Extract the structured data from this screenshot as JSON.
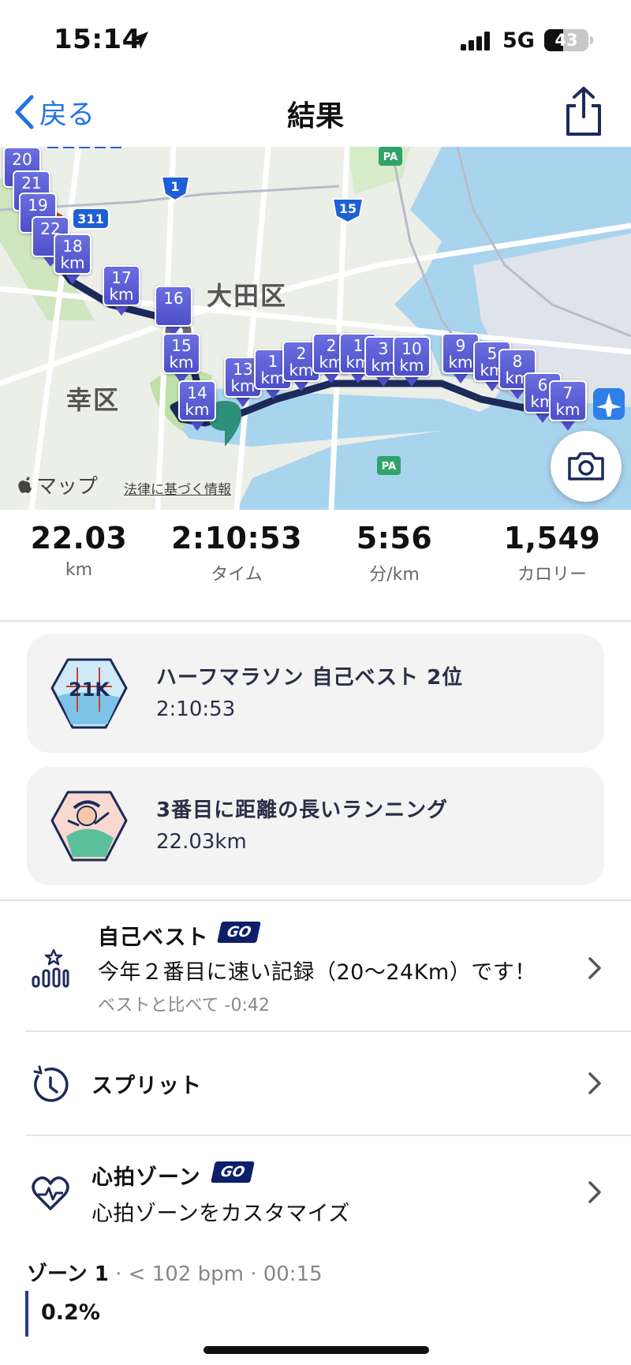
{
  "status": {
    "time": "15:14",
    "network": "5G",
    "battery": "43",
    "battery_level": 0.43
  },
  "nav": {
    "back_label": "戻る",
    "title": "結果"
  },
  "map": {
    "district_label": "大田区",
    "ward_label": "幸区",
    "attribution": "マップ",
    "legal": "法律に基づく情報",
    "route_signs": [
      "1",
      "15",
      "311",
      "PA",
      "PA"
    ],
    "pins": [
      {
        "t1": "20",
        "t2": ""
      },
      {
        "t1": "21",
        "t2": ""
      },
      {
        "t1": "19",
        "t2": ""
      },
      {
        "t1": "22",
        "t2": ""
      },
      {
        "t1": "18",
        "t2": "km"
      },
      {
        "t1": "17",
        "t2": "km"
      },
      {
        "t1": "16",
        "t2": ""
      },
      {
        "t1": "15",
        "t2": "km"
      },
      {
        "t1": "14",
        "t2": "km"
      },
      {
        "t1": "13",
        "t2": "km"
      },
      {
        "t1": "1",
        "t2": "km"
      },
      {
        "t1": "2",
        "t2": "km"
      },
      {
        "t1": "2",
        "t2": "km"
      },
      {
        "t1": "1",
        "t2": "km"
      },
      {
        "t1": "3",
        "t2": "km"
      },
      {
        "t1": "10",
        "t2": "km"
      },
      {
        "t1": "9",
        "t2": "km"
      },
      {
        "t1": "5",
        "t2": "km"
      },
      {
        "t1": "8",
        "t2": "km"
      },
      {
        "t1": "6",
        "t2": "km"
      },
      {
        "t1": "7",
        "t2": "km"
      }
    ]
  },
  "stats": [
    {
      "value": "22.03",
      "label": "km"
    },
    {
      "value": "2:10:53",
      "label": "タイム"
    },
    {
      "value": "5:56",
      "label": "分/km"
    },
    {
      "value": "1,549",
      "label": "カロリー"
    }
  ],
  "achievements": [
    {
      "title": "ハーフマラソン 自己ベスト 2位",
      "subtitle": "2:10:53",
      "badge_text": "21K"
    },
    {
      "title": "3番目に距離の長いランニング",
      "subtitle": "22.03km"
    }
  ],
  "personal_best": {
    "title": "自己ベスト",
    "go": "GO",
    "text": "今年２番目に速い記録（20〜24Km）です！",
    "note": "ベストと比べて -0:42"
  },
  "splits": {
    "title": "スプリット"
  },
  "heart_zone": {
    "title": "心拍ゾーン",
    "go": "GO",
    "text": "心拍ゾーンをカスタマイズ"
  },
  "zone1": {
    "name": "ゾーン 1",
    "range": "< 102 bpm",
    "time": "00:15",
    "percent": "0.2%"
  },
  "colors": {
    "accent": "#1f73e6",
    "pin": "#5b5fd6",
    "go_badge": "#0d1f6b",
    "route": "#1c2a5a"
  }
}
